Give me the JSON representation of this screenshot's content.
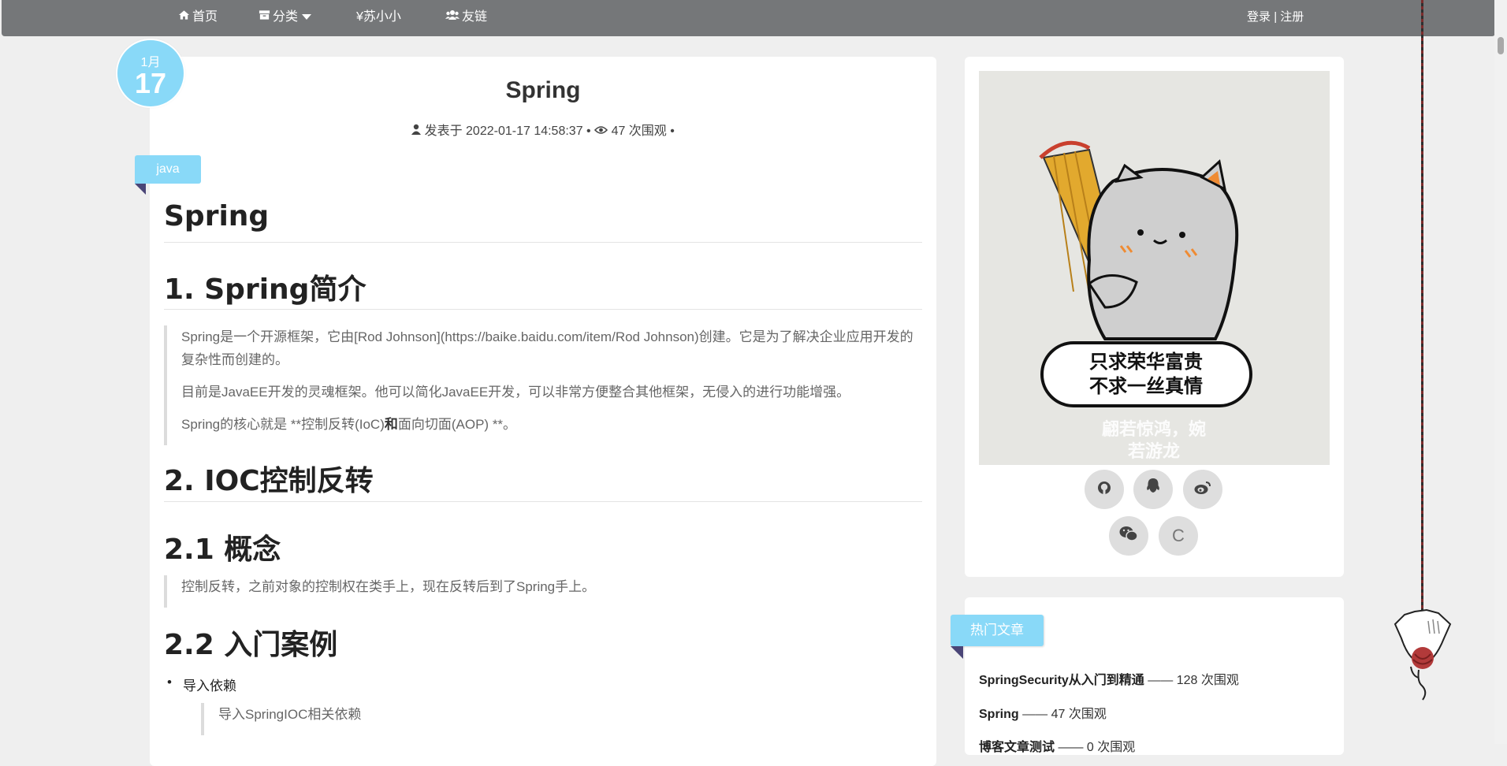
{
  "nav": {
    "home": "首页",
    "category": "分类",
    "author": "¥苏小小",
    "links": "友链",
    "login": "登录",
    "separator": "|",
    "register": "注册"
  },
  "post": {
    "month": "1月",
    "day": "17",
    "title": "Spring",
    "published_label": "发表于 2022-01-17 14:58:37 •",
    "views_label": "47 次围观 •",
    "tag": "java"
  },
  "content": {
    "h_main": "Spring",
    "h_intro": "1. Spring简介",
    "intro_p1": "Spring是一个开源框架，它由[Rod Johnson](https://baike.baidu.com/item/Rod Johnson)创建。它是为了解决企业应用开发的复杂性而创建的。",
    "intro_p2": "目前是JavaEE开发的灵魂框架。他可以简化JavaEE开发，可以非常方便整合其他框架，无侵入的进行功能增强。",
    "intro_p3_a": "Spring的核心就是 **控制反转(IoC)",
    "intro_p3_b": "和",
    "intro_p3_c": "面向切面(AOP) **。",
    "h_ioc": "2. IOC控制反转",
    "h_concept": "2.1 概念",
    "concept_p": "控制反转，之前对象的控制权在类手上，现在反转后到了Spring手上。",
    "h_example": "2.2 入门案例",
    "bullet_1": "导入依赖",
    "sub_quote": "导入SpringIOC相关依赖"
  },
  "sidebar": {
    "badge_line1": "只求荣华富贵",
    "badge_line2": "不求一丝真情",
    "watermark_line1": "翩若惊鸿，婉",
    "watermark_line2": "若游龙",
    "social": [
      "github-icon",
      "qq-icon",
      "weibo-icon",
      "wechat-icon",
      "csdn-icon"
    ],
    "csdn_letter": "C",
    "hot_title": "热门文章",
    "hot": [
      {
        "title": "SpringSecurity从入门到精通",
        "views": "—— 128 次围观"
      },
      {
        "title": "Spring",
        "views": "—— 47 次围观"
      },
      {
        "title": "博客文章测试",
        "views": "—— 0 次围观"
      }
    ]
  },
  "colors": {
    "nav_bg": "#757779",
    "accent": "#89d9f8",
    "ribbon_fold": "#4a4577",
    "page_bg": "#efefef"
  }
}
